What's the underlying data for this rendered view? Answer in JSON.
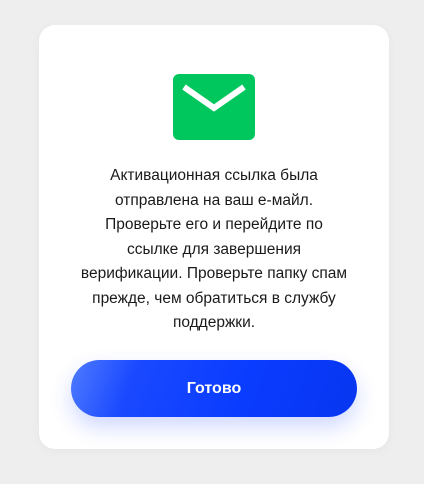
{
  "dialog": {
    "icon": "envelope-icon",
    "icon_color": "#00c75d",
    "message": "Активационная ссылка была\nотправлена на ваш е-майл.\nПроверьте его и перейдите по\nссылке для завершения\nверификации. Проверьте папку спам\nпрежде, чем обратиться в службу\nподдержки.",
    "button_label": "Готово",
    "button_color": "#0a3cff"
  }
}
